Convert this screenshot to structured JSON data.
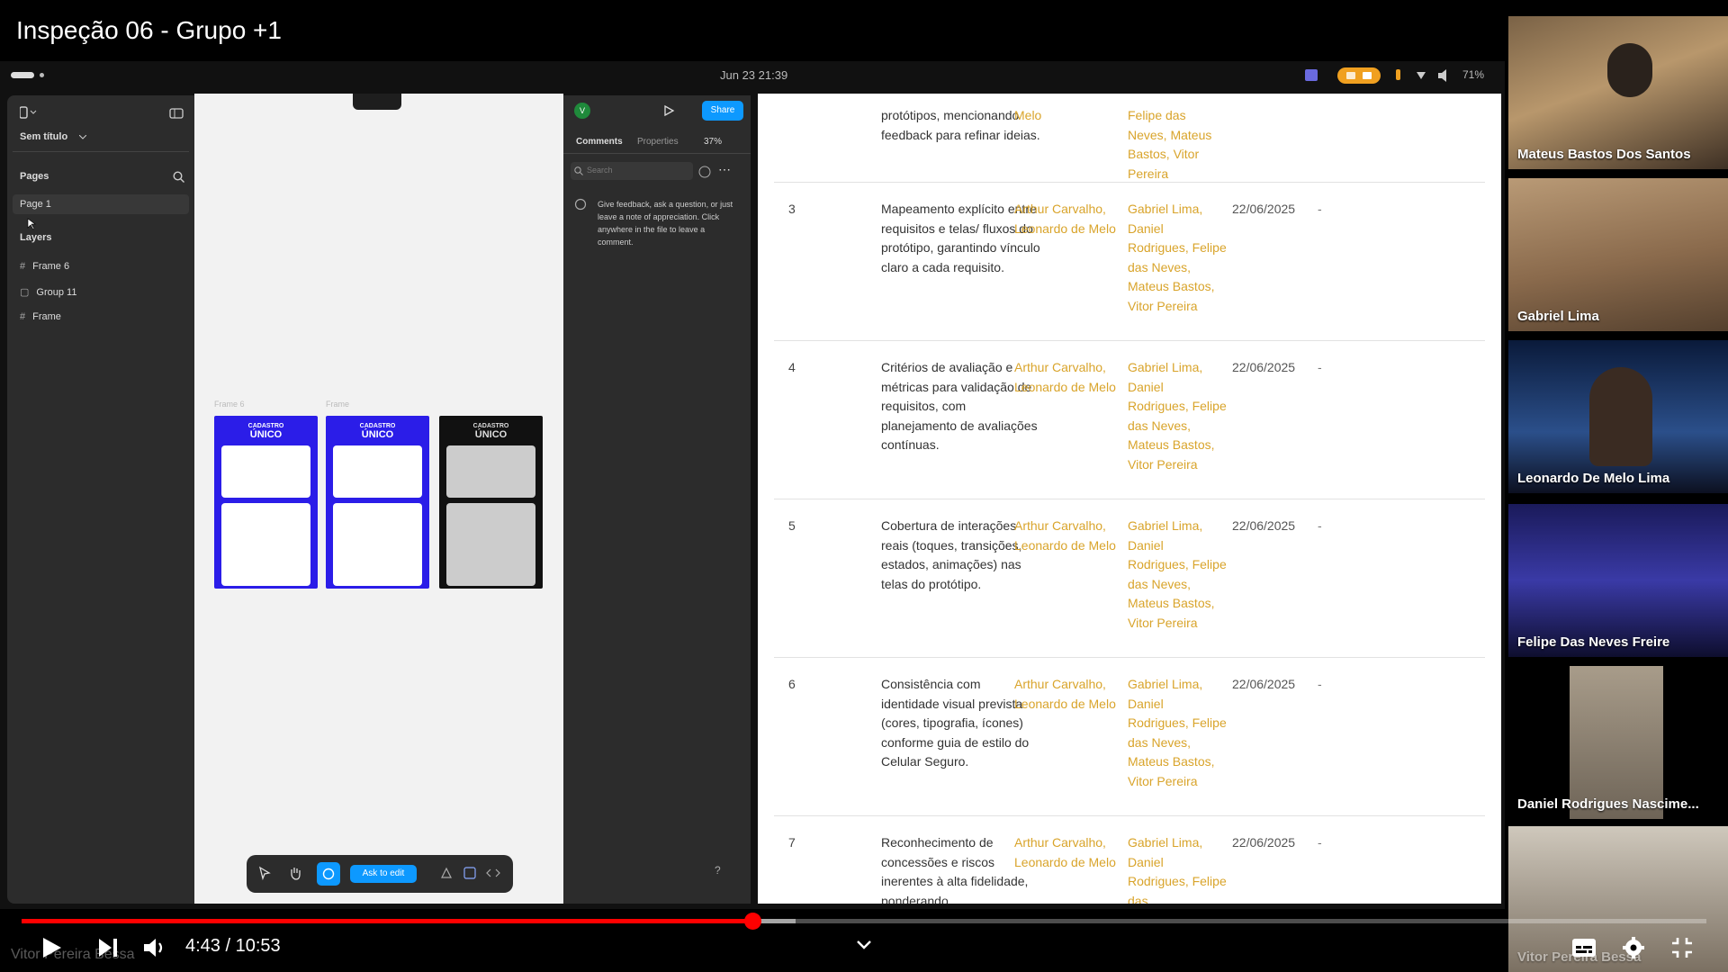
{
  "video": {
    "title": "Inspeção 06 - Grupo +1",
    "time_current": "4:43",
    "time_separator": "/",
    "time_total": "10:53",
    "progress_fraction": 0.4335,
    "presenter_watermark": "Vitor Pereira Bessa"
  },
  "ipad_status": {
    "time": "Jun 23  21:39",
    "battery": "71%"
  },
  "figma": {
    "file_name": "Sem título",
    "pages_heading": "Pages",
    "page_1": "Page 1",
    "layers_heading": "Layers",
    "layers": [
      "Frame 6",
      "Group 11",
      "Frame"
    ],
    "avatar_letter": "V",
    "share_label": "Share",
    "tab_comments": "Comments",
    "tab_properties": "Properties",
    "zoom": "37%",
    "search_placeholder": "Search",
    "comment_hint": "Give feedback, ask a question, or just leave a note of appreciation. Click anywhere in the file to leave a comment.",
    "frame_label_1": "Frame 6",
    "frame_label_2": "Frame",
    "mock_title_small": "CADASTRO",
    "mock_title_big": "ÚNICO",
    "ask_to_edit": "Ask to edit",
    "help": "?"
  },
  "doc": {
    "row0": {
      "desc": "protótipos, mencionando feedback para refinar ideias.",
      "resp": "Melo",
      "ins": "Felipe das Neves, Mateus Bastos, Vitor Pereira"
    },
    "rows": [
      {
        "num": "3",
        "desc": "Mapeamento explícito entre requisitos e telas/ fluxos do protótipo, garantindo vínculo claro a cada requisito.",
        "resp": "Arthur Carvalho, Leonardo de Melo",
        "ins": "Gabriel Lima, Daniel Rodrigues, Felipe das Neves, Mateus Bastos, Vitor Pereira",
        "date": "22/06/2025",
        "dash": "-"
      },
      {
        "num": "4",
        "desc": "Critérios de avaliação e métricas para validação de requisitos, com planejamento de avaliações contínuas.",
        "resp": "Arthur Carvalho, Leonardo de Melo",
        "ins": "Gabriel Lima, Daniel Rodrigues, Felipe das Neves, Mateus Bastos, Vitor Pereira",
        "date": "22/06/2025",
        "dash": "-"
      },
      {
        "num": "5",
        "desc": "Cobertura de interações reais (toques, transições, estados, animações) nas telas do protótipo.",
        "resp": "Arthur Carvalho, Leonardo de Melo",
        "ins": "Gabriel Lima, Daniel Rodrigues, Felipe das Neves, Mateus Bastos, Vitor Pereira",
        "date": "22/06/2025",
        "dash": "-"
      },
      {
        "num": "6",
        "desc": "Consistência com identidade visual prevista (cores, tipografia, ícones) conforme guia de estilo do Celular Seguro.",
        "resp": "Arthur Carvalho, Leonardo de Melo",
        "ins": "Gabriel Lima, Daniel Rodrigues, Felipe das Neves, Mateus Bastos, Vitor Pereira",
        "date": "22/06/2025",
        "dash": "-"
      },
      {
        "num": "7",
        "desc": "Reconhecimento de concessões e riscos inerentes à alta fidelidade, ponderando",
        "resp": "Arthur Carvalho, Leonardo de Melo",
        "ins": "Gabriel Lima, Daniel Rodrigues, Felipe das",
        "date": "22/06/2025",
        "dash": "-"
      }
    ]
  },
  "participants": [
    "Mateus Bastos Dos Santos",
    "Gabriel Lima",
    "Leonardo De Melo Lima",
    "Felipe Das Neves Freire",
    "Daniel Rodrigues Nascime...",
    "Vitor Pereira Bessa"
  ],
  "colors": {
    "progress": "#ff0000",
    "figma_blue": "#0d99ff",
    "frame_purple": "#2b1de8",
    "doc_accent": "#d9a42b"
  }
}
